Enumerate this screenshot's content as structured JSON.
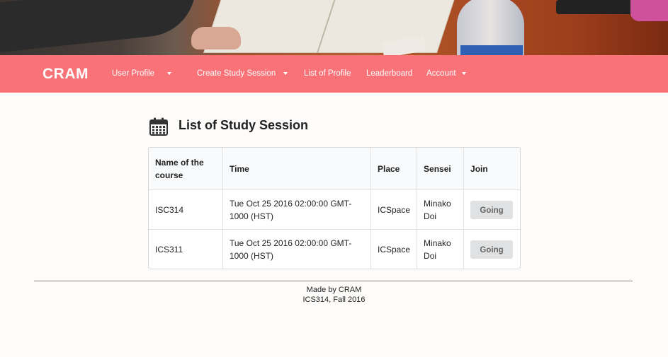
{
  "navbar": {
    "brand": "CRAM",
    "items": [
      {
        "label": "User Profile",
        "has_dropdown": true
      },
      {
        "label": "Create Study Session",
        "has_dropdown": true
      },
      {
        "label": "List of Profile",
        "has_dropdown": false
      },
      {
        "label": "Leaderboard",
        "has_dropdown": false
      },
      {
        "label": "Account",
        "has_dropdown": true
      }
    ],
    "color": "#f87277"
  },
  "page": {
    "title": "List of Study Session",
    "title_icon": "calendar-icon"
  },
  "table": {
    "headers": [
      "Name of the course",
      "Time",
      "Place",
      "Sensei",
      "Join"
    ],
    "rows": [
      {
        "course": "ISC314",
        "time": "Tue Oct 25 2016 02:00:00 GMT-1000 (HST)",
        "place": "ICSpace",
        "sensei": "Minako Doi",
        "join_label": "Going"
      },
      {
        "course": "ICS311",
        "time": "Tue Oct 25 2016 02:00:00 GMT-1000 (HST)",
        "place": "ICSpace",
        "sensei": "Minako Doi",
        "join_label": "Going"
      }
    ]
  },
  "footer": {
    "line1": "Made by CRAM",
    "line2": "ICS314, Fall 2016"
  }
}
